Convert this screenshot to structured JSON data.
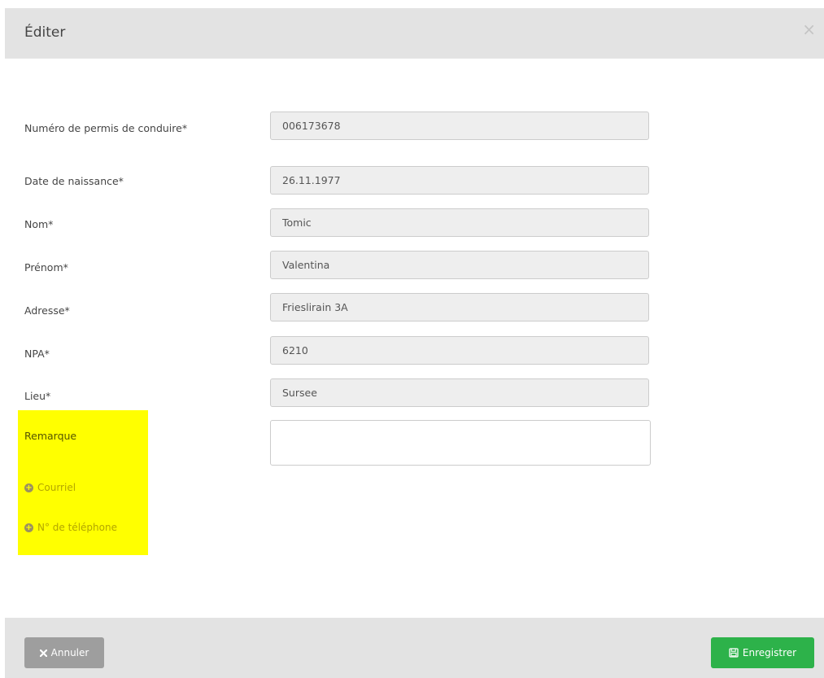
{
  "dialog": {
    "title": "Éditer",
    "close_symbol": "×"
  },
  "fields": {
    "license": {
      "label": "Numéro de permis de conduire*",
      "value": "006173678"
    },
    "birthdate": {
      "label": "Date de naissance*",
      "value": "26.11.1977"
    },
    "lastname": {
      "label": "Nom*",
      "value": "Tomic"
    },
    "firstname": {
      "label": "Prénom*",
      "value": "Valentina"
    },
    "address": {
      "label": "Adresse*",
      "value": "Frieslirain 3A"
    },
    "zip": {
      "label": "NPA*",
      "value": "6210"
    },
    "city": {
      "label": "Lieu*",
      "value": "Sursee"
    },
    "remark": {
      "label": "Remarque",
      "value": ""
    }
  },
  "links": {
    "email": "Courriel",
    "phone": "N° de téléphone"
  },
  "footer": {
    "cancel_label": "Annuler",
    "save_label": "Enregistrer"
  },
  "colors": {
    "header_bg": "#e3e3e3",
    "highlight": "#ffff00",
    "save_button": "#2db24a",
    "cancel_button": "#9e9e9e"
  },
  "icons": [
    "close-icon",
    "plus-circle-icon",
    "times-icon",
    "floppy-disk-icon"
  ]
}
